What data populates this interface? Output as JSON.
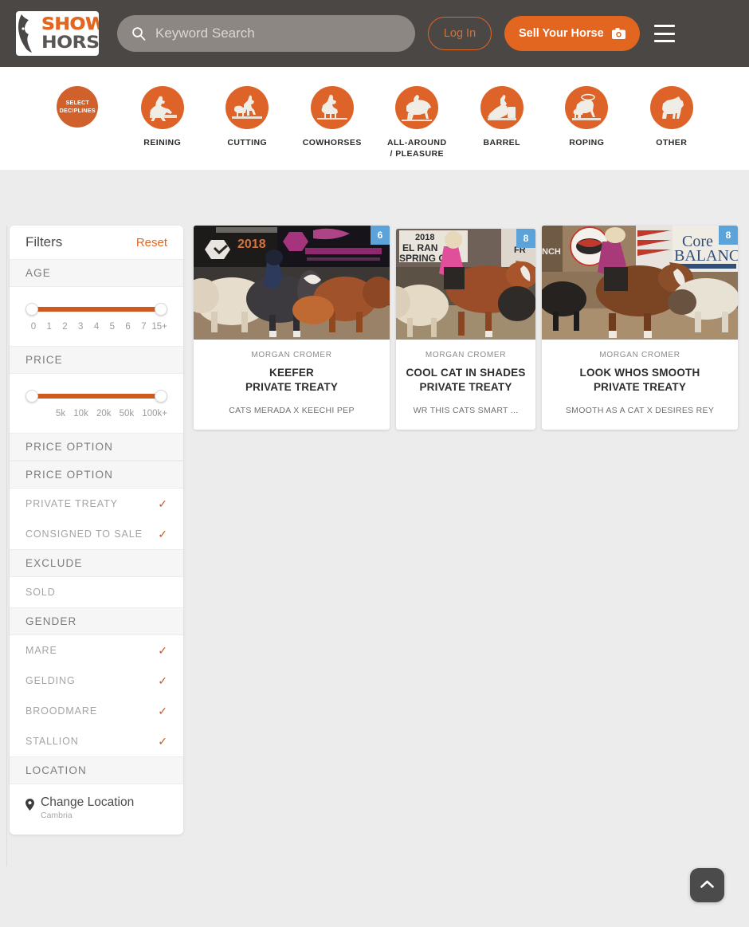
{
  "header": {
    "logo": {
      "line1": "SHOW",
      "line2": "HORSE.CO",
      "icon": "horse-head-icon"
    },
    "search": {
      "placeholder": "Keyword Search",
      "value": "",
      "icon": "search-icon"
    },
    "login_label": "Log In",
    "sell_label": "Sell Your Horse",
    "sell_icon": "camera-icon",
    "menu_icon": "hamburger-menu-icon",
    "bg_color": "#4a4745",
    "accent_color": "#e2661f"
  },
  "disciplines": [
    {
      "label": "SELECT\nDECIPLINES",
      "icon": "select-disciplines-icon",
      "is_select": true,
      "caption": ""
    },
    {
      "label": "",
      "icon": "reining-horse-icon",
      "is_select": false,
      "caption": "REINING"
    },
    {
      "label": "",
      "icon": "cutting-horse-icon",
      "is_select": false,
      "caption": "CUTTING"
    },
    {
      "label": "",
      "icon": "cowhorse-icon",
      "is_select": false,
      "caption": "COWHORSES"
    },
    {
      "label": "",
      "icon": "all-around-pleasure-icon",
      "is_select": false,
      "caption": "ALL-AROUND\n/ PLEASURE"
    },
    {
      "label": "",
      "icon": "barrel-racing-icon",
      "is_select": false,
      "caption": "BARREL"
    },
    {
      "label": "",
      "icon": "roping-icon",
      "is_select": false,
      "caption": "ROPING"
    },
    {
      "label": "",
      "icon": "other-horse-icon",
      "is_select": false,
      "caption": "OTHER"
    }
  ],
  "sidebar": {
    "title": "Filters",
    "reset_label": "Reset",
    "age": {
      "header": "AGE",
      "ticks": [
        "0",
        "1",
        "2",
        "3",
        "4",
        "5",
        "6",
        "7",
        "15+"
      ],
      "min": "0",
      "max": "15+"
    },
    "price": {
      "header": "PRICE",
      "ticks": [
        "5k",
        "10k",
        "20k",
        "50k",
        "100k+"
      ],
      "min": "0",
      "max": "100k+"
    },
    "price_option_header_1": "PRICE OPTION",
    "price_option_header_2": "PRICE OPTION",
    "price_options": [
      {
        "label": "PRIVATE TREATY",
        "checked": true
      },
      {
        "label": "CONSIGNED TO SALE",
        "checked": true
      }
    ],
    "exclude_header": "EXCLUDE",
    "exclude_options": [
      {
        "label": "SOLD",
        "checked": false
      }
    ],
    "gender_header": "GENDER",
    "gender_options": [
      {
        "label": "MARE",
        "checked": true
      },
      {
        "label": "GELDING",
        "checked": true
      },
      {
        "label": "BROODMARE",
        "checked": true
      },
      {
        "label": "STALLION",
        "checked": true
      }
    ],
    "location_header": "LOCATION",
    "location": {
      "label": "Change Location",
      "value": "Cambria",
      "icon": "map-pin-icon"
    },
    "check_glyph": "✓"
  },
  "listings": [
    {
      "seller": "MORGAN CROMER",
      "name": "KEEFER",
      "price": "PRIVATE TREATY",
      "pedigree": "CATS MERADA X KEECHI PEP",
      "badge": "6",
      "badge_color": "#5ba3d8"
    },
    {
      "seller": "MORGAN CROMER",
      "name": "COOL CAT IN SHADES",
      "price": "PRIVATE TREATY",
      "pedigree": "WR THIS CATS SMART ...",
      "badge": "8",
      "badge_color": "#5ba3d8"
    },
    {
      "seller": "MORGAN CROMER",
      "name": "LOOK WHOS SMOOTH",
      "price": "PRIVATE TREATY",
      "pedigree": "SMOOTH AS A CAT X DESIRES REY",
      "badge": "8",
      "badge_color": "#5ba3d8"
    }
  ],
  "scroll_top": {
    "icon": "chevron-up-icon"
  }
}
